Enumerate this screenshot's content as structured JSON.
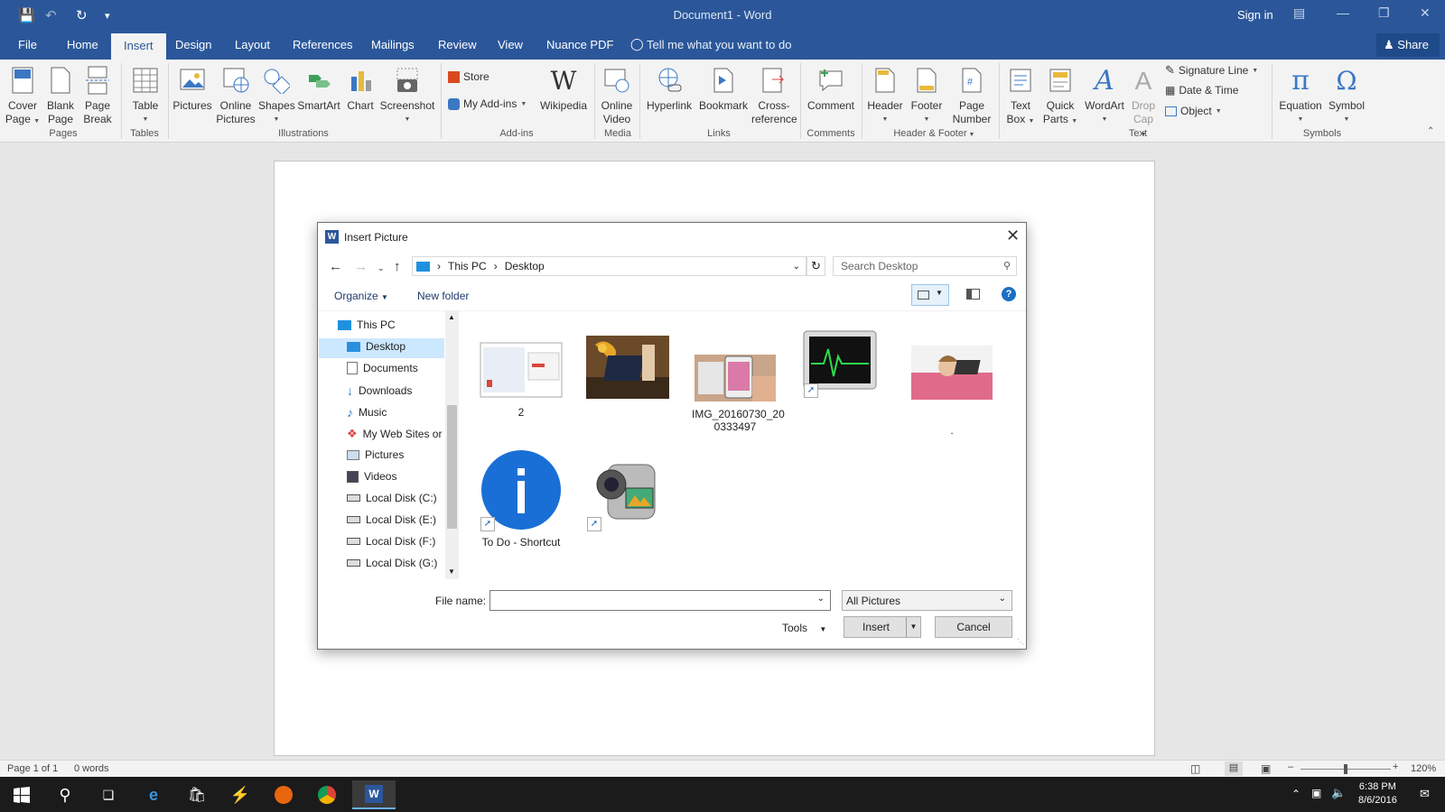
{
  "titlebar": {
    "title": "Document1 - Word",
    "sign_in": "Sign in"
  },
  "tabs": [
    "File",
    "Home",
    "Insert",
    "Design",
    "Layout",
    "References",
    "Mailings",
    "Review",
    "View",
    "Nuance PDF"
  ],
  "active_tab": "Insert",
  "tell_me": "Tell me what you want to do",
  "share": "Share",
  "ribbon": {
    "cover_page": [
      "Cover",
      "Page"
    ],
    "blank_page": [
      "Blank",
      "Page"
    ],
    "page_break": [
      "Page",
      "Break"
    ],
    "table": "Table",
    "pictures": "Pictures",
    "online_pictures": [
      "Online",
      "Pictures"
    ],
    "shapes": "Shapes",
    "smartart": "SmartArt",
    "chart": "Chart",
    "screenshot": "Screenshot",
    "store": "Store",
    "my_addins": "My Add-ins",
    "wikipedia": "Wikipedia",
    "online_video": [
      "Online",
      "Video"
    ],
    "hyperlink": "Hyperlink",
    "bookmark": "Bookmark",
    "cross_reference": [
      "Cross-",
      "reference"
    ],
    "comment": "Comment",
    "header": "Header",
    "footer": "Footer",
    "page_number": [
      "Page",
      "Number"
    ],
    "text_box": [
      "Text",
      "Box"
    ],
    "quick_parts": [
      "Quick",
      "Parts"
    ],
    "wordart": "WordArt",
    "drop_cap": [
      "Drop",
      "Cap"
    ],
    "signature_line": "Signature Line",
    "date_time": "Date & Time",
    "object": "Object",
    "equation": "Equation",
    "symbol": "Symbol",
    "groups": [
      "Pages",
      "Tables",
      "Illustrations",
      "Add-ins",
      "Media",
      "Links",
      "Comments",
      "Header & Footer",
      "Text",
      "Symbols"
    ]
  },
  "dialog": {
    "title": "Insert Picture",
    "breadcrumb": [
      "This PC",
      "Desktop"
    ],
    "search_placeholder": "Search Desktop",
    "organize": "Organize",
    "new_folder": "New folder",
    "nav_items": [
      "This PC",
      "Desktop",
      "Documents",
      "Downloads",
      "Music",
      "My Web Sites or",
      "Pictures",
      "Videos",
      "Local Disk (C:)",
      "Local Disk (E:)",
      "Local Disk (F:)",
      "Local Disk (G:)"
    ],
    "selected_nav": "Desktop",
    "files": [
      {
        "name": "2",
        "kind": "screenshot"
      },
      {
        "name": "",
        "kind": "photo-tablet"
      },
      {
        "name": "IMG_20160730_20",
        "name2": "0333497",
        "kind": "photo-phone"
      },
      {
        "name": "",
        "kind": "activity-monitor",
        "shortcut": true
      },
      {
        "name": ".",
        "kind": "photo-woman"
      },
      {
        "name": "To Do - Shortcut",
        "kind": "info-icon",
        "shortcut": true
      },
      {
        "name": "",
        "kind": "camcorder",
        "shortcut": true
      }
    ],
    "file_name_label": "File name:",
    "file_name_value": "",
    "filter": "All Pictures",
    "tools": "Tools",
    "insert": "Insert",
    "cancel": "Cancel"
  },
  "status": {
    "page": "Page 1 of 1",
    "words": "0 words",
    "zoom": "120%"
  },
  "tray": {
    "time": "6:38 PM",
    "date": "8/6/2016"
  }
}
